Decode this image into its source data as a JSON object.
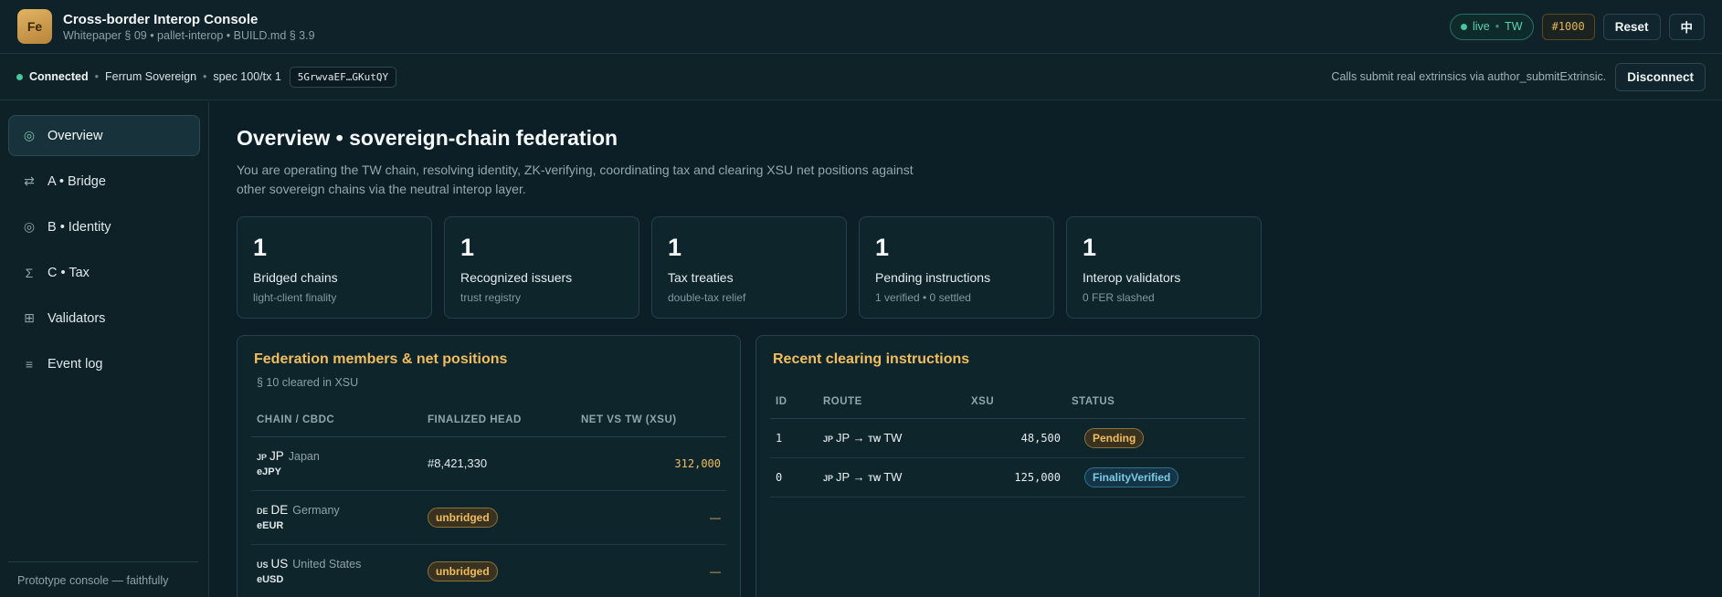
{
  "header": {
    "logo": "Fe",
    "title": "Cross-border Interop Console",
    "subtitle": "Whitepaper § 09  •  pallet-interop  •  BUILD.md  § 3.9",
    "live_label": "live",
    "live_chain": "TW",
    "block": "#1000",
    "reset_label": "Reset",
    "lang_label": "中"
  },
  "connection": {
    "status": "Connected",
    "network": "Ferrum Sovereign",
    "spec": "spec 100/tx 1",
    "address": "5GrwvaEF…GKutQY",
    "note": "Calls submit real extrinsics via author_submitExtrinsic.",
    "disconnect_label": "Disconnect"
  },
  "sidebar": {
    "items": [
      {
        "label": "Overview",
        "icon": "overview-ring-icon",
        "glyph": "◎"
      },
      {
        "label": "A  •  Bridge",
        "icon": "bridge-arrows-icon",
        "glyph": "⇄"
      },
      {
        "label": "B  •  Identity",
        "icon": "identity-target-icon",
        "glyph": "◎"
      },
      {
        "label": "C  •  Tax",
        "icon": "sigma-icon",
        "glyph": "Σ"
      },
      {
        "label": "Validators",
        "icon": "grid-icon",
        "glyph": "⊞"
      },
      {
        "label": "Event log",
        "icon": "list-icon",
        "glyph": "≡"
      }
    ],
    "footer": "Prototype console — faithfully"
  },
  "main": {
    "title": "Overview  •  sovereign-chain federation",
    "lede": "You are operating the TW chain, resolving identity, ZK-verifying, coordinating tax and clearing XSU net positions against other sovereign chains via the neutral interop layer.",
    "stats": [
      {
        "value": "1",
        "label": "Bridged chains",
        "sub": "light-client finality"
      },
      {
        "value": "1",
        "label": "Recognized issuers",
        "sub": "trust registry"
      },
      {
        "value": "1",
        "label": "Tax treaties",
        "sub": "double-tax relief"
      },
      {
        "value": "1",
        "label": "Pending instructions",
        "sub": "1 verified  •  0 settled"
      },
      {
        "value": "1",
        "label": "Interop validators",
        "sub": "0 FER slashed"
      }
    ]
  },
  "federation": {
    "title": "Federation members & net positions",
    "subtitle": "§ 10 cleared in XSU",
    "headers": [
      "CHAIN / CBDC",
      "FINALIZED HEAD",
      "NET VS TW (XSU)"
    ],
    "rows": [
      {
        "flag": "JP",
        "code": "JP",
        "name": "Japan",
        "cbdc": "eJPY",
        "head": "#8,421,330",
        "net": "312,000"
      },
      {
        "flag": "DE",
        "code": "DE",
        "name": "Germany",
        "cbdc": "eEUR",
        "head": "unbridged",
        "net": "—"
      },
      {
        "flag": "US",
        "code": "US",
        "name": "United States",
        "cbdc": "eUSD",
        "head": "unbridged",
        "net": "—"
      }
    ]
  },
  "clearing": {
    "title": "Recent clearing instructions",
    "headers": [
      "ID",
      "ROUTE",
      "XSU",
      "STATUS"
    ],
    "rows": [
      {
        "id": "1",
        "from_flag": "JP",
        "from": "JP",
        "arrow": "→",
        "to_flag": "TW",
        "to": "TW",
        "xsu": "48,500",
        "status": "Pending"
      },
      {
        "id": "0",
        "from_flag": "JP",
        "from": "JP",
        "arrow": "→",
        "to_flag": "TW",
        "to": "TW",
        "xsu": "125,000",
        "status": "FinalityVerified"
      }
    ]
  }
}
